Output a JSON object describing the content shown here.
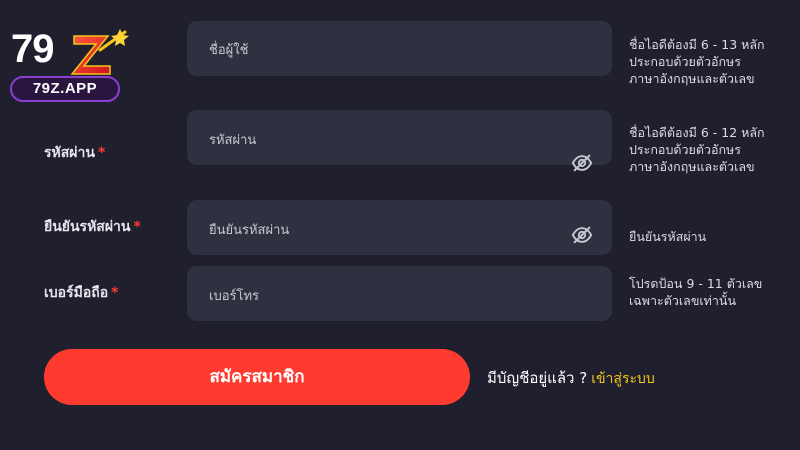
{
  "logo": {
    "number": "79",
    "letter": "Z",
    "site": "79Z.APP"
  },
  "form": {
    "username": {
      "placeholder": "ชื่อผู้ใช้",
      "hint": "ชื่อไอดีต้องมี 6 - 13 หลักประกอบด้วยตัวอักษรภาษาอังกฤษและตัวเลข"
    },
    "password": {
      "label": "รหัสผ่าน",
      "required_mark": "*",
      "placeholder": "รหัสผ่าน",
      "hint": "ชื่อไอดีต้องมี 6 - 12 หลักประกอบด้วยตัวอักษรภาษาอังกฤษและตัวเลข",
      "toggle_icon": "eye-slash-icon"
    },
    "confirm_password": {
      "label": "ยืนยันรหัสผ่าน",
      "required_mark": "*",
      "placeholder": "ยืนยันรหัสผ่าน",
      "hint": "ยืนยันรหัสผ่าน",
      "toggle_icon": "eye-slash-icon"
    },
    "phone": {
      "label": "เบอร์มือถือ",
      "required_mark": "*",
      "placeholder": "เบอร์โทร",
      "hint": "โปรดป้อน 9 - 11 ตัวเลข เฉพาะตัวเลขเท่านั้น"
    }
  },
  "actions": {
    "register_label": "สมัครสมาชิก",
    "have_account_text": "มีบัญชีอยู่แล้ว ?",
    "login_label": "เข้าสู่ระบบ"
  },
  "colors": {
    "background": "#1f1f2e",
    "field": "#2f3040",
    "accent_red": "#ff3b30",
    "link_yellow": "#f5c518",
    "logo_purple": "#8a3fd0"
  }
}
